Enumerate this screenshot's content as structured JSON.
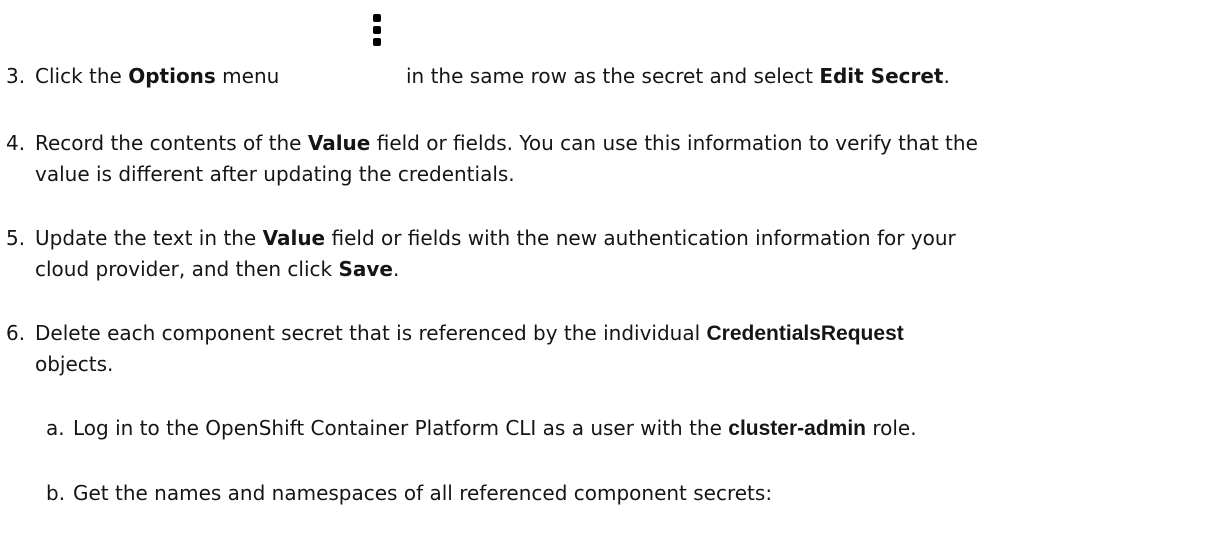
{
  "steps": [
    {
      "number": "3.",
      "parts": {
        "t1": "Click the ",
        "b1": "Options",
        "t2": " menu",
        "t3": "in the same row as the secret and select ",
        "b2": "Edit Secret",
        "t4": "."
      },
      "icon": "kebab-icon"
    },
    {
      "number": "4.",
      "line1": {
        "t1": "Record the contents of the ",
        "b1": "Value",
        "t2": " field or fields. You can use this information to verify that the"
      },
      "line2": "value is different after updating the credentials."
    },
    {
      "number": "5.",
      "line1": {
        "t1": "Update the text in the ",
        "b1": "Value",
        "t2": " field or fields with the new authentication information for your"
      },
      "line2": {
        "t1": "cloud provider, and then click ",
        "b1": "Save",
        "t2": "."
      }
    },
    {
      "number": "6.",
      "line1": {
        "t1": "Delete each component secret that is referenced by the individual ",
        "b1": "CredentialsRequest"
      },
      "line2": "objects.",
      "substeps": [
        {
          "letter": "a.",
          "t1": "Log in to the OpenShift Container Platform CLI as a user with the ",
          "b1": "cluster-admin",
          "t2": " role."
        },
        {
          "letter": "b.",
          "t1": "Get the names and namespaces of all referenced component secrets:"
        }
      ]
    }
  ]
}
